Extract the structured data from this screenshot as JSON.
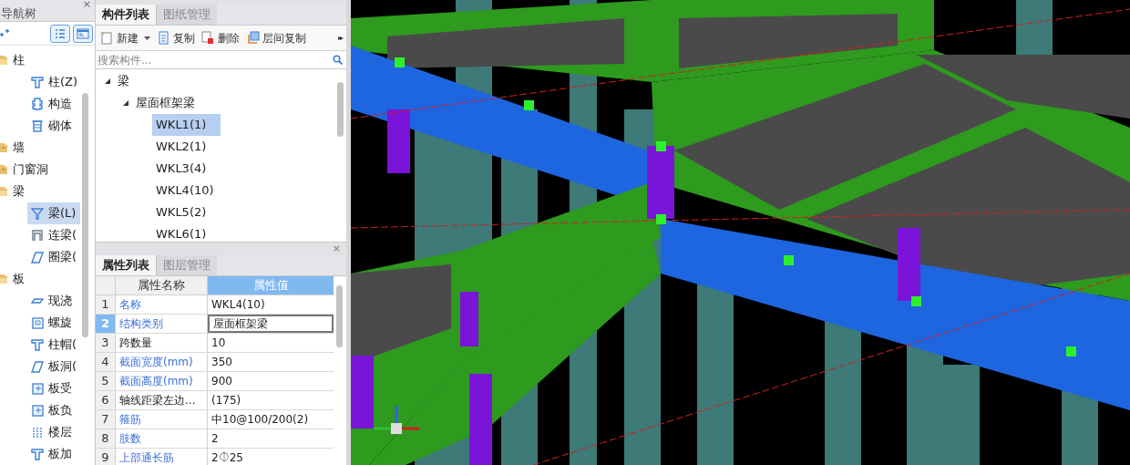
{
  "nav_tree": {
    "title": "导航树",
    "close": "×",
    "items": [
      {
        "label": "柱",
        "expanded": true,
        "children": [
          {
            "label": "柱(Z)",
            "kind": "column",
            "selected": false
          },
          {
            "label": "构造",
            "kind": "puzzle",
            "selected": false
          },
          {
            "label": "砌体",
            "kind": "masonry",
            "selected": false
          }
        ]
      },
      {
        "label": "墙",
        "expanded": false
      },
      {
        "label": "门窗洞",
        "expanded": false
      },
      {
        "label": "梁",
        "expanded": true,
        "children": [
          {
            "label": "梁(L)",
            "kind": "funnel",
            "selected": true
          },
          {
            "label": "连梁(",
            "kind": "arch",
            "selected": false
          },
          {
            "label": "圈梁(",
            "kind": "parallelogram",
            "selected": false
          }
        ]
      },
      {
        "label": "板",
        "expanded": true,
        "children": [
          {
            "label": "现浇",
            "kind": "slab",
            "selected": false
          },
          {
            "label": "螺旋",
            "kind": "spiral",
            "selected": false
          },
          {
            "label": "柱帽(",
            "kind": "column",
            "selected": false
          },
          {
            "label": "板洞(",
            "kind": "parallelogram",
            "selected": false
          },
          {
            "label": "板受",
            "kind": "rebar",
            "selected": false
          },
          {
            "label": "板负",
            "kind": "rebar",
            "selected": false
          },
          {
            "label": "楼层",
            "kind": "grid",
            "selected": false
          },
          {
            "label": "板加",
            "kind": "column",
            "selected": false
          }
        ]
      }
    ]
  },
  "component_panel": {
    "tabs": [
      {
        "label": "构件列表",
        "selected": true
      },
      {
        "label": "图纸管理",
        "selected": false
      }
    ],
    "toolbar": [
      {
        "label": "新建",
        "kind": "new",
        "dropdown": true
      },
      {
        "label": "复制",
        "kind": "copy",
        "dropdown": false
      },
      {
        "label": "删除",
        "kind": "delete",
        "dropdown": false
      },
      {
        "label": "层间复制",
        "kind": "floor-copy",
        "dropdown": false
      }
    ],
    "overflow": "▸▸",
    "search": {
      "placeholder": "搜索构件..."
    },
    "tree": [
      {
        "label": "梁",
        "expanded": true,
        "children": [
          {
            "label": "屋面框架梁",
            "expanded": true,
            "children": [
              {
                "label": "WKL1(1)",
                "selected": true
              },
              {
                "label": "WKL2(1)",
                "selected": false
              },
              {
                "label": "WKL3(4)",
                "selected": false
              },
              {
                "label": "WKL4(10)",
                "selected": false
              },
              {
                "label": "WKL5(2)",
                "selected": false
              },
              {
                "label": "WKL6(1)",
                "selected": false
              }
            ]
          }
        ]
      }
    ]
  },
  "property_panel": {
    "close": "×",
    "tabs": [
      {
        "label": "属性列表",
        "selected": true
      },
      {
        "label": "图层管理",
        "selected": false
      }
    ],
    "columns": [
      "属性名称",
      "属性值"
    ],
    "rows": [
      {
        "index": "1",
        "name": "名称",
        "value": "WKL4(10)",
        "public": true,
        "selected": false
      },
      {
        "index": "2",
        "name": "结构类别",
        "value": "屋面框架梁",
        "public": true,
        "selected": true
      },
      {
        "index": "3",
        "name": "跨数量",
        "value": "10",
        "public": false,
        "selected": false
      },
      {
        "index": "4",
        "name": "截面宽度(mm)",
        "value": "350",
        "public": true,
        "selected": false
      },
      {
        "index": "5",
        "name": "截面高度(mm)",
        "value": "900",
        "public": true,
        "selected": false
      },
      {
        "index": "6",
        "name": "轴线距梁左边...",
        "value": "(175)",
        "public": false,
        "selected": false
      },
      {
        "index": "7",
        "name": "箍筋",
        "value": "中10@100/200(2)",
        "public": true,
        "selected": false
      },
      {
        "index": "8",
        "name": "肢数",
        "value": "2",
        "public": true,
        "selected": false
      },
      {
        "index": "9",
        "name": "上部通长筋",
        "value": "2⏀25",
        "public": true,
        "selected": false
      }
    ]
  }
}
